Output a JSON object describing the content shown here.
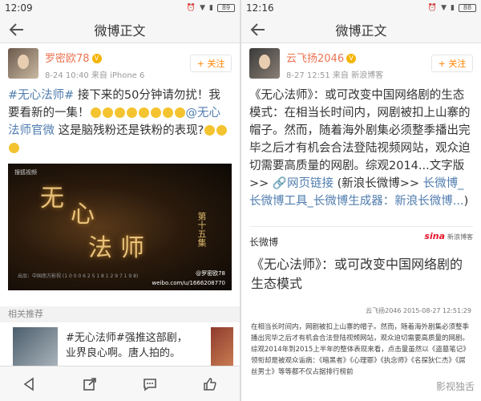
{
  "left": {
    "status": {
      "time": "12:09",
      "battery": "89"
    },
    "title": "微博正文",
    "user": {
      "name": "罗密欧78",
      "time": "8-24 10:40",
      "source": "来自 iPhone 6"
    },
    "follow_label": "+ 关注",
    "post": {
      "hashtag": "#无心法师#",
      "text1": " 接下来的50分钟请勿扰！我要看新的一集！",
      "mention": "@无心法师官微",
      "text2": " 这是脑残粉还是铁粉的表现?"
    },
    "poster": {
      "corner": "搜狐视频",
      "big1": "无",
      "big2": "心",
      "big3": "法",
      "big4": "师",
      "episode": "第十五集",
      "small": "出品：中国南方影视 (1 0 0 0 6 2 5 1 8 1 2 9 7 1 9 8)",
      "wm1": "@罗密欧78",
      "wm2": "weibo.com/u/1666208770"
    },
    "rec_label": "相关推荐",
    "rec": {
      "line1": "#无心法师#强推这部剧，",
      "line2": "业界良心啊。唐人拍的。"
    }
  },
  "right": {
    "status": {
      "time": "12:16",
      "battery": "88"
    },
    "title": "微博正文",
    "user": {
      "name": "云飞扬2046",
      "time": "8-27 12:51",
      "source": "来自 新浪博客"
    },
    "follow_label": "+ 关注",
    "post": {
      "text": "《无心法师》：或可改变中国网络剧的生态模式：在相当长时间内，网剧被扣上山寨的帽子。然而，随着海外剧集必须整季播出完毕之后才有机会合法登陆视频网站，观众迫切需要高质量的网剧。综观2014...文字版>> ",
      "link1": "网页链接",
      "text2": " (新浪长微博>> ",
      "link2": "长微博_长微博工具_长微博生成器：新浪长微博...",
      "text3": ")"
    },
    "long": {
      "label": "长微博",
      "sina": "sina",
      "sina_sub": "新浪博客",
      "title": "《无心法师》：或可改变中国网络剧的生态模式",
      "byline": "云飞扬2046    2015-08-27 12:51:29",
      "body": "在相当长时间内，网剧被扣上山寨的帽子。然而，随着海外剧集必须整季播出完毕之后才有机会合法登陆视频网站，观众迫切需要高质量的网剧。综观2014年到2015上半年的整体表现来看，点击量虽然以《盗墓笔记》领衔却是被观众诟病：《暗黑者》《心理罪》《执念师》《名探狄仁杰》《屌丝男士》等等都不仅占据排行榜前"
    },
    "watermark": "影视独舌"
  }
}
